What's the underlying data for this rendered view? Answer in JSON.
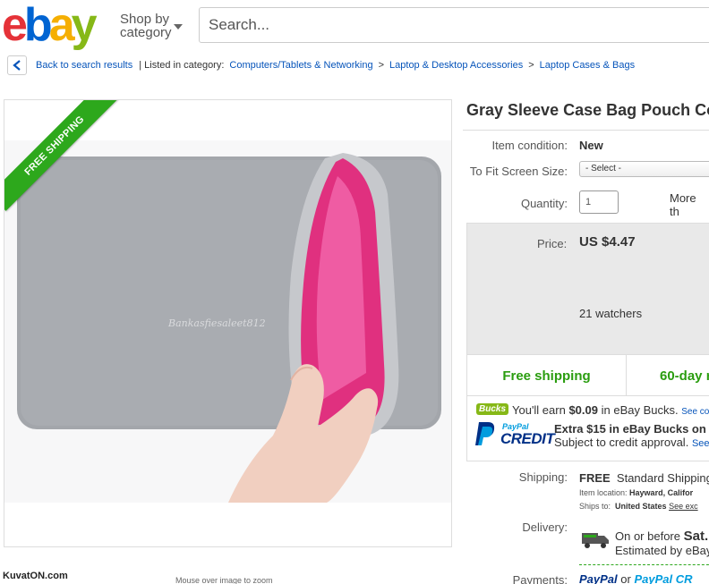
{
  "header": {
    "logo": {
      "e": "e",
      "b": "b",
      "a": "a",
      "y": "y"
    },
    "shop_by_line1": "Shop by",
    "shop_by_line2": "category",
    "search_placeholder": "Search..."
  },
  "breadcrumb": {
    "back": "Back to search results",
    "listed": "| Listed in category:",
    "items": [
      "Computers/Tablets & Networking",
      "Laptop & Desktop Accessories",
      "Laptop Cases & Bags"
    ],
    "separator": ">"
  },
  "image": {
    "ribbon": "FREE SHIPPING",
    "zoom_hint": "Mouse over image to zoom",
    "site_watermark": "KuvatON.com",
    "seller_watermark": "Bankasfiesaleet812"
  },
  "listing": {
    "title": "Gray Sleeve Case Bag Pouch Co",
    "condition_label": "Item condition:",
    "condition_value": "New",
    "fit_label": "To Fit Screen Size:",
    "fit_value": "- Select -",
    "quantity_label": "Quantity:",
    "quantity_value": "1",
    "more_than": "More th",
    "price_label": "Price:",
    "price_value": "US $4.47",
    "watchers": "21 watchers",
    "free_shipping": "Free shipping",
    "returns": "60-day r",
    "bucks_badge": "Bucks",
    "bucks_text_1": "You'll earn ",
    "bucks_amount": "$0.09",
    "bucks_text_2": " in eBay Bucks.",
    "bucks_link": "See co",
    "paypal_word": "PayPal",
    "credit_word": "CREDIT",
    "credit_offer": "Extra $15 in eBay Bucks on",
    "credit_sub": "Subject to credit approval.",
    "credit_link": "See",
    "shipping_label": "Shipping:",
    "shipping_free": "FREE",
    "shipping_type": "Standard Shipping",
    "location_label": "Item location:",
    "location_value": "Hayward, Califor",
    "ships_to_label": "Ships to:",
    "ships_to_value": "United States",
    "ships_to_link": "See exc",
    "delivery_label": "Delivery:",
    "delivery_line1_a": "On or before ",
    "delivery_line1_b": "Sat.",
    "delivery_line2": "Estimated by eBay",
    "payments_label": "Payments:",
    "payments_pp1": "PayPal",
    "payments_or": "or",
    "payments_pp2": "PayPal CR"
  },
  "colors": {
    "link": "#0654ba",
    "green": "#2a9d0f",
    "ribbon": "#2da81c",
    "price_bg": "#e9e9e9"
  }
}
